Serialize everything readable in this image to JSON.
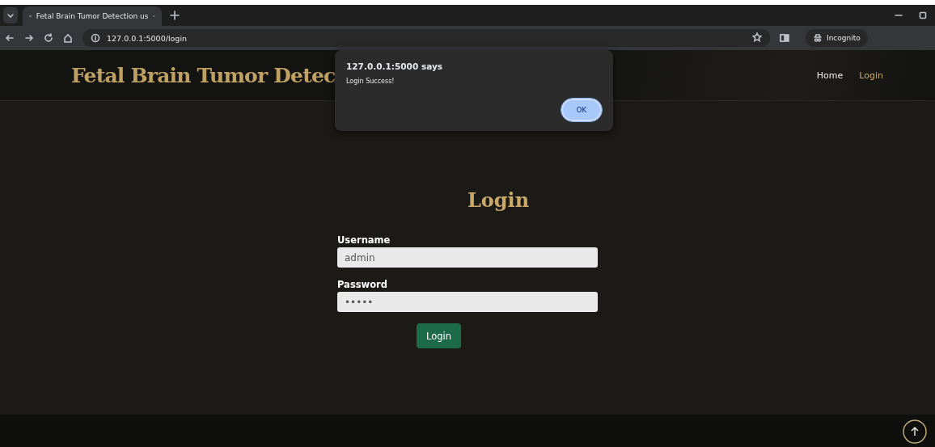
{
  "browser": {
    "tab_title": "Fetal Brain Tumor Detection us",
    "address": "127.0.0.1:5000/login",
    "incognito_label": "Incognito"
  },
  "header": {
    "title": "Fetal Brain Tumor Detec",
    "nav": [
      {
        "label": "Home",
        "selected": false
      },
      {
        "label": "Login",
        "selected": true
      }
    ]
  },
  "login_form": {
    "heading": "Login",
    "fields": [
      {
        "label": "Username",
        "value": "admin"
      },
      {
        "label": "Password",
        "value": "•••••"
      }
    ],
    "button": "Login"
  },
  "dialog": {
    "title": "127.0.0.1:5000 says",
    "message": "Login Success!",
    "button": "OK"
  }
}
